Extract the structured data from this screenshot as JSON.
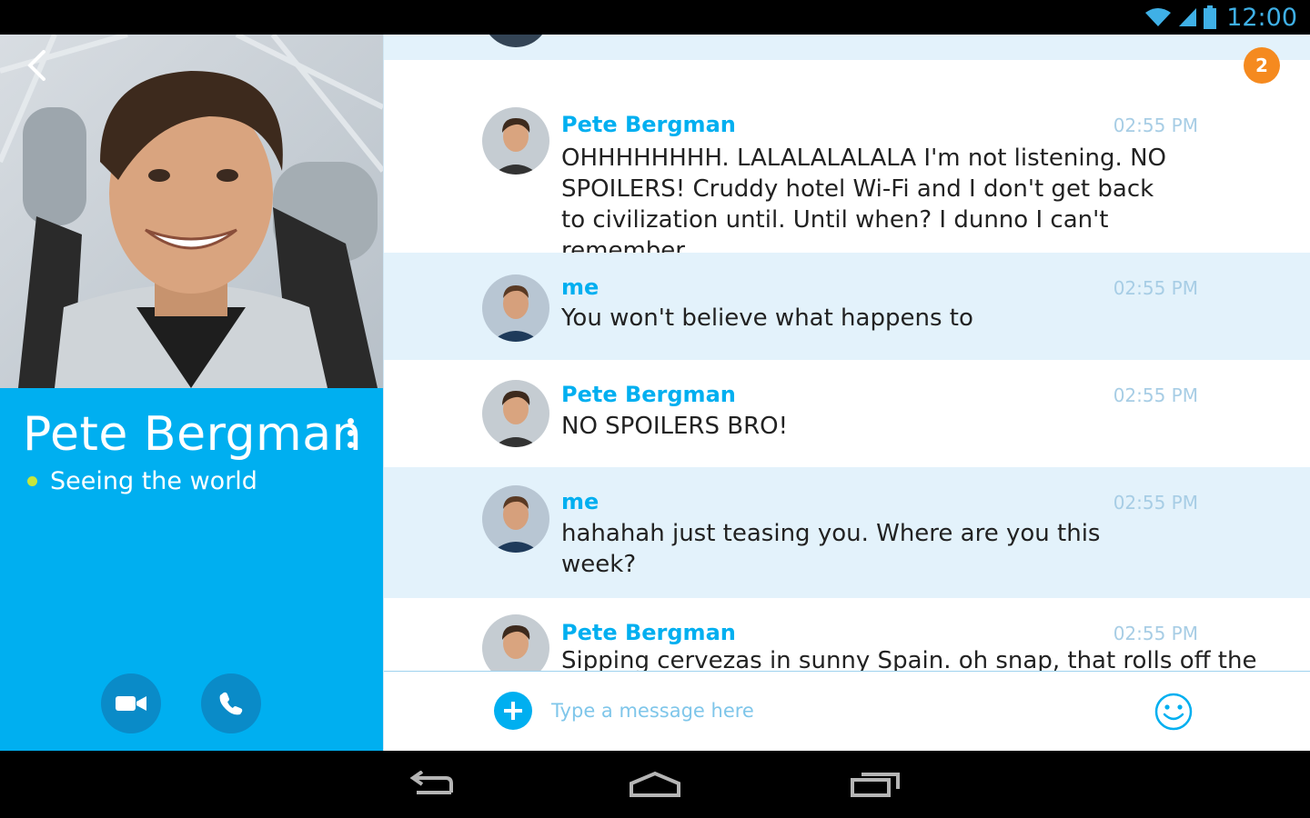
{
  "status_bar": {
    "time": "12:00",
    "icons": [
      "wifi-icon",
      "signal-icon",
      "battery-icon"
    ]
  },
  "contact": {
    "name": "Pete Bergman",
    "mood": "Seeing the world",
    "presence_color": "#c6e63c"
  },
  "chat": {
    "unread_count": "2",
    "messages": [
      {
        "sender": "Pete Bergman",
        "time": "02:55 PM",
        "text": "OHHHHHHHH. LALALALALALA I'm not listening. NO SPOILERS! Cruddy hotel Wi-Fi and I don't get back to civilization until. Until when? I dunno I can't remember",
        "from_me": false
      },
      {
        "sender": "me",
        "time": "02:55 PM",
        "text": "You won't believe what happens to",
        "from_me": true
      },
      {
        "sender": "Pete Bergman",
        "time": "02:55 PM",
        "text": "NO SPOILERS BRO!",
        "from_me": false
      },
      {
        "sender": "me",
        "time": "02:55 PM",
        "text": "hahahah just teasing you. Where are you this week?",
        "from_me": true
      },
      {
        "sender": "Pete Bergman",
        "time": "02:55 PM",
        "text": "Sipping cervezas in sunny Spain. oh snap, that rolls off the",
        "from_me": false
      }
    ]
  },
  "composer": {
    "placeholder": "Type a message here"
  },
  "colors": {
    "brand": "#00aff0",
    "badge": "#f58a1f",
    "me_bubble": "#e3f2fb"
  }
}
